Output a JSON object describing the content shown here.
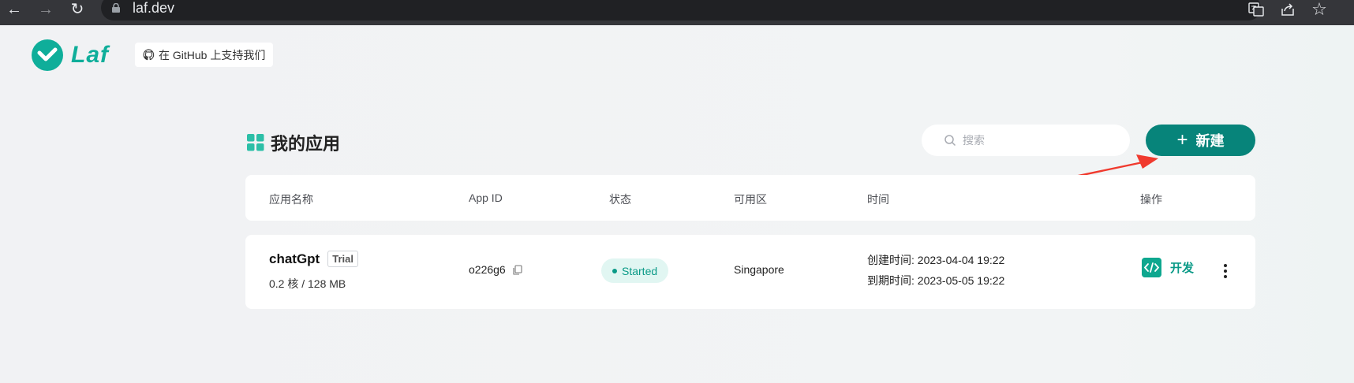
{
  "browser": {
    "back_glyph": "←",
    "forward_glyph": "→",
    "reload_glyph": "↻",
    "url": "laf.dev",
    "bookmark_glyph": "☆"
  },
  "header": {
    "logo_text": "Laf",
    "github_button": "在 GitHub 上支持我们"
  },
  "main": {
    "title": "我的应用",
    "search_placeholder": "搜索",
    "new_button": "新建",
    "new_glyph": "+"
  },
  "table": {
    "columns": [
      "应用名称",
      "App ID",
      "状态",
      "可用区",
      "时间",
      "操作"
    ],
    "rows": [
      {
        "name": "chatGpt",
        "badge": "Trial",
        "spec": "0.2 核 / 128 MB",
        "app_id": "o226g6",
        "status": "Started",
        "region": "Singapore",
        "created": "创建时间: 2023-04-04 19:22",
        "expires": "到期时间: 2023-05-05 19:22",
        "action": "开发"
      }
    ]
  },
  "colors": {
    "brand": "#0fae9a",
    "primary_button": "#07847a",
    "status_bg": "#e1f6f2",
    "status_text": "#0a9a87",
    "annotation_arrow": "#f03a2e"
  }
}
